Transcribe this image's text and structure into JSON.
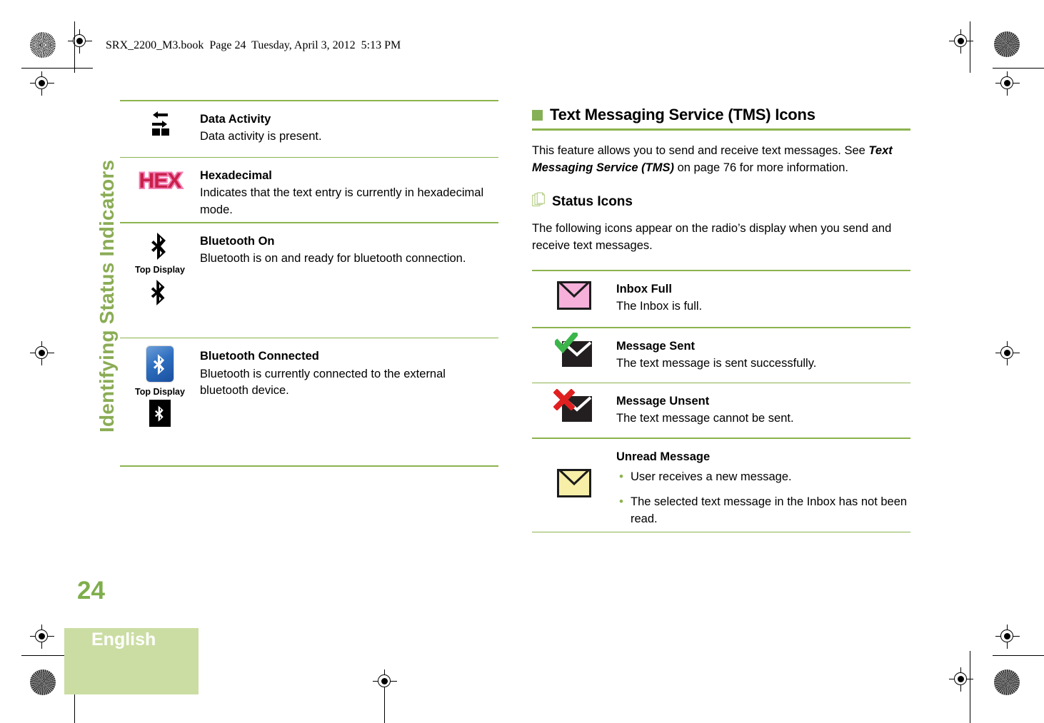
{
  "document": {
    "book_header": "SRX_2200_M3.book  Page 24  Tuesday, April 3, 2012  5:13 PM",
    "side_tab": "Identifying Status Indicators",
    "page_number": "24",
    "language": "English"
  },
  "theme": {
    "green": "#8cb34e",
    "green_bullet": "#86b055",
    "green_block": "#cbdda3",
    "page_number_green": "#7fae4b",
    "side_tab_green": "#8aac55",
    "hex_pink": "#f180b5",
    "hex_red": "#c9204a",
    "envelope_pink": "#f6b0da",
    "envelope_yellow": "#f7efa8",
    "bluetooth_blue": "#2f6fc0",
    "check_green": "#3cb54a",
    "cross_red": "#e02020"
  },
  "left_column": {
    "rows": [
      {
        "icon": "data-activity-icon",
        "title": "Data Activity",
        "desc": "Data activity is present."
      },
      {
        "icon": "hexadecimal-icon",
        "icon_text": "HEX",
        "title": "Hexadecimal",
        "desc": "Indicates that the text entry is currently in hexadecimal mode."
      },
      {
        "icon": "bluetooth-on-icon",
        "caption": "Top Display",
        "title": "Bluetooth On",
        "desc": "Bluetooth is on and ready for bluetooth connection."
      },
      {
        "icon": "bluetooth-connected-icon",
        "caption": "Top Display",
        "title": "Bluetooth Connected",
        "desc": "Bluetooth is currently connected to the external bluetooth device."
      }
    ]
  },
  "right_column": {
    "heading": "Text Messaging Service (TMS) Icons",
    "intro_before": "This feature allows you to send and receive text messages. See ",
    "intro_emphasis": "Text Messaging Service (TMS)",
    "intro_after": " on page 76 for more information.",
    "subheading": "Status Icons",
    "subintro": "The following icons appear on the radio’s display when you send and receive text messages.",
    "rows": [
      {
        "icon": "inbox-full-icon",
        "title": "Inbox Full",
        "desc": "The Inbox is full."
      },
      {
        "icon": "message-sent-icon",
        "title": "Message Sent",
        "desc": "The text message is sent successfully."
      },
      {
        "icon": "message-unsent-icon",
        "title": "Message Unsent",
        "desc": "The text message cannot be sent."
      },
      {
        "icon": "unread-message-icon",
        "title": "Unread Message",
        "bullets": [
          "User receives a new message.",
          "The selected text message in the Inbox has not been read."
        ]
      }
    ]
  }
}
